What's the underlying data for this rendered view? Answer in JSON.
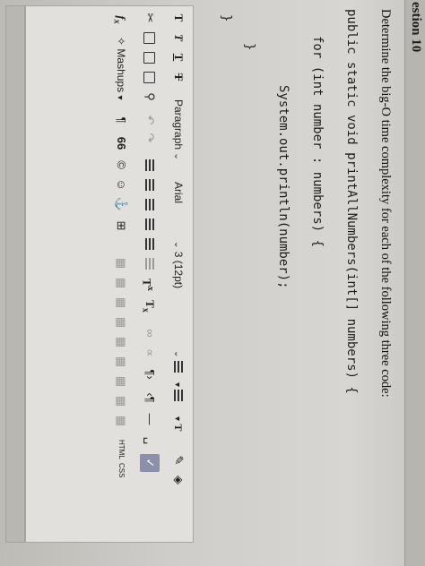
{
  "question": {
    "title": "estion 10",
    "prompt": "Determine the big-O time complexity for each of the following three code:"
  },
  "code": {
    "lines": [
      "public static void printAllNumbers(int[] numbers) {",
      "for (int number : numbers) {",
      "System.out.println(number);",
      "}",
      "}"
    ]
  },
  "toolbar": {
    "row1": {
      "bold": "T",
      "italic": "T",
      "underline": "T",
      "strikethrough": "T",
      "paragraph": "Paragraph",
      "font": "Arial",
      "size": "3 (12pt)",
      "text_color": "T"
    },
    "row2": {
      "superscript": "T",
      "subscript": "T"
    },
    "row3": {
      "formula": "f",
      "mashups": "Mashups",
      "paragraph_mark": "¶",
      "quote": "66",
      "html": "HTML",
      "css": "CSS"
    }
  },
  "icons": [
    "bold-icon",
    "italic-icon",
    "underline-icon",
    "strikethrough-icon",
    "scissors-icon",
    "copy-icon",
    "paste-icon",
    "paste-text-icon",
    "search-icon",
    "undo-icon",
    "redo-icon",
    "align-left-icon",
    "align-center-icon",
    "align-right-icon",
    "align-justify-icon",
    "indent-icon",
    "outdent-icon",
    "bullet-list-icon",
    "numbered-list-icon",
    "text-color-icon",
    "highlighter-icon",
    "eraser-icon",
    "link-icon",
    "unlink-icon",
    "ltr-icon",
    "rtl-icon",
    "horizontal-rule-icon",
    "nbsp-icon",
    "spellcheck-icon",
    "formula-icon",
    "mashups-icon",
    "emoji-icon",
    "anchor-icon",
    "table-icon",
    "grid-icon",
    "html-icon",
    "css-icon"
  ]
}
